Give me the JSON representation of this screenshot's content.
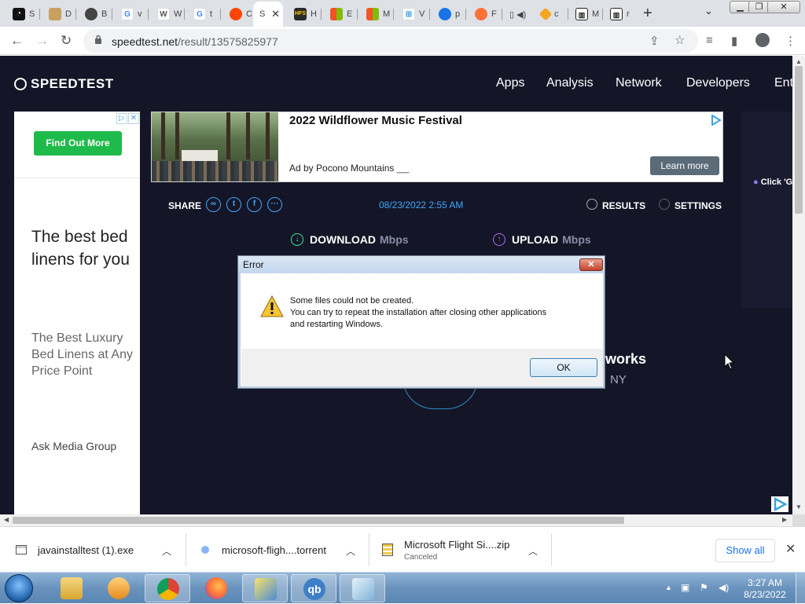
{
  "browser": {
    "tabs": [
      {
        "letter": "S",
        "color": "#111111"
      },
      {
        "letter": "D",
        "color": "#b48a3a"
      },
      {
        "letter": "B",
        "color": "#333333"
      },
      {
        "letter": "v",
        "color": "#4285f4"
      },
      {
        "letter": "W",
        "color": "#777777"
      },
      {
        "letter": "t",
        "color": "#4285f4"
      },
      {
        "letter": "C",
        "color": "#ff4500"
      },
      {
        "letter": "S",
        "color": "#ffffff"
      },
      {
        "letter": "H",
        "color": "#2b2b2b"
      },
      {
        "letter": "E",
        "color": "#f35325"
      },
      {
        "letter": "M",
        "color": "#f35325"
      },
      {
        "letter": "V",
        "color": "#3ca3e6"
      },
      {
        "letter": "p",
        "color": "#1a73e8"
      },
      {
        "letter": "F",
        "color": "#ff7139"
      },
      {
        "letter": "",
        "color": "#555555"
      },
      {
        "letter": "c",
        "color": "#f5a623"
      },
      {
        "letter": "M",
        "color": "#222222"
      },
      {
        "letter": "r",
        "color": "#222222"
      }
    ],
    "new_tab": "+",
    "url_domain": "speedtest.net",
    "url_path": "/result/13575825977"
  },
  "site": {
    "logo": "SPEEDTEST",
    "nav": [
      "Apps",
      "Analysis",
      "Network",
      "Developers",
      "Ent"
    ]
  },
  "left_ad": {
    "cta": "Find Out More",
    "headline": "The best bed linens for you",
    "subhead": "The Best Luxury Bed Linens at Any Price Point",
    "advertiser": "Ask Media Group"
  },
  "top_ad": {
    "title": "2022 Wildflower Music Festival",
    "by": "Ad by Pocono Mountains",
    "cta": "Learn more"
  },
  "right_strip": {
    "text": "Click 'G"
  },
  "result": {
    "share_label": "SHARE",
    "date": "08/23/2022 2:55 AM",
    "results_label": "RESULTS",
    "settings_label": "SETTINGS",
    "download_label": "DOWNLOAD",
    "upload_label": "UPLOAD",
    "unit": "Mbps",
    "isp_partial": "works",
    "location_partial": "NY"
  },
  "dialog": {
    "title": "Error",
    "line1": "Some files could not be created.",
    "line2": "You can try to repeat the installation after closing other applications",
    "line3": "and restarting Windows.",
    "ok": "OK"
  },
  "downloads": {
    "items": [
      {
        "name": "javainstalltest (1).exe",
        "status": ""
      },
      {
        "name": "microsoft-fligh....torrent",
        "status": ""
      },
      {
        "name": "Microsoft Flight Si....zip",
        "status": "Canceled"
      }
    ],
    "show_all": "Show all"
  },
  "taskbar": {
    "time": "3:27 AM",
    "date": "8/23/2022"
  }
}
